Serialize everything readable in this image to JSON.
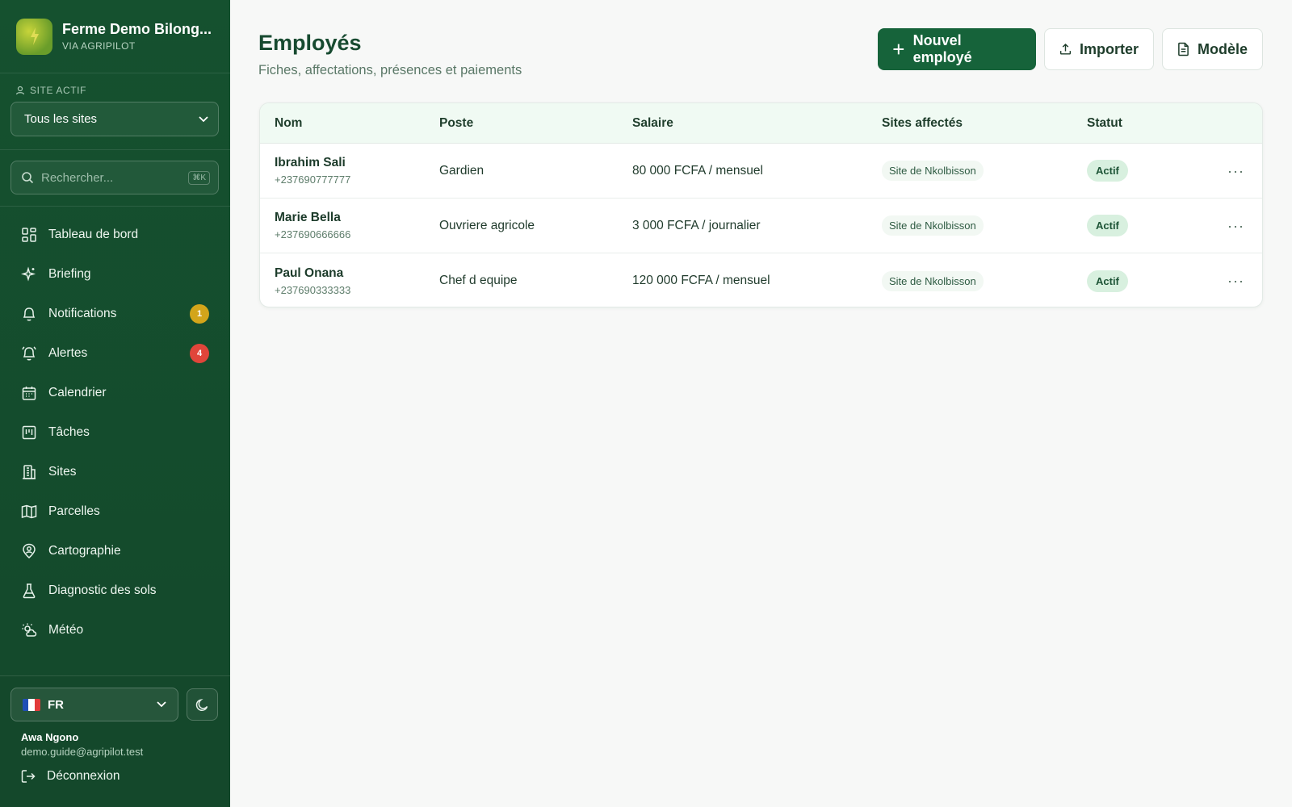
{
  "sidebar": {
    "brand_title": "Ferme Demo Bilong...",
    "brand_sub": "VIA AGRIPILOT",
    "site_label": "SITE ACTIF",
    "site_value": "Tous les sites",
    "search_placeholder": "Rechercher...",
    "search_shortcut": "⌘K",
    "items": [
      {
        "label": "Tableau de bord",
        "icon": "dashboard-icon"
      },
      {
        "label": "Briefing",
        "icon": "sparkle-icon"
      },
      {
        "label": "Notifications",
        "icon": "bell-icon",
        "badge": "1",
        "badge_color": "#d3a51a"
      },
      {
        "label": "Alertes",
        "icon": "alarm-bell-icon",
        "badge": "4",
        "badge_color": "#e0453a"
      },
      {
        "label": "Calendrier",
        "icon": "calendar-icon"
      },
      {
        "label": "Tâches",
        "icon": "kanban-icon"
      },
      {
        "label": "Sites",
        "icon": "building-icon"
      },
      {
        "label": "Parcelles",
        "icon": "map-icon"
      },
      {
        "label": "Cartographie",
        "icon": "map-pin-user-icon"
      },
      {
        "label": "Diagnostic des sols",
        "icon": "flask-icon"
      },
      {
        "label": "Météo",
        "icon": "sun-cloud-icon"
      }
    ],
    "footer": {
      "lang": "FR",
      "user_name": "Awa Ngono",
      "user_email": "demo.guide@agripilot.test",
      "logout": "Déconnexion"
    }
  },
  "page": {
    "title": "Employés",
    "subtitle": "Fiches, affectations, présences et paiements",
    "buttons": {
      "new": "Nouvel employé",
      "import": "Importer",
      "template": "Modèle"
    }
  },
  "table": {
    "headers": {
      "name": "Nom",
      "poste": "Poste",
      "salary": "Salaire",
      "sites": "Sites affectés",
      "status": "Statut"
    },
    "rows": [
      {
        "name": "Ibrahim Sali",
        "phone": "+237690777777",
        "poste": "Gardien",
        "salary": "80 000 FCFA / mensuel",
        "site": "Site de Nkolbisson",
        "status": "Actif"
      },
      {
        "name": "Marie Bella",
        "phone": "+237690666666",
        "poste": "Ouvriere agricole",
        "salary": "3 000 FCFA / journalier",
        "site": "Site de Nkolbisson",
        "status": "Actif"
      },
      {
        "name": "Paul Onana",
        "phone": "+237690333333",
        "poste": "Chef d equipe",
        "salary": "120 000 FCFA / mensuel",
        "site": "Site de Nkolbisson",
        "status": "Actif"
      }
    ],
    "more_label": "···"
  },
  "colors": {
    "sidebar_bg": "#15512f",
    "primary": "#16633a",
    "status_bg": "#d8f0df"
  }
}
